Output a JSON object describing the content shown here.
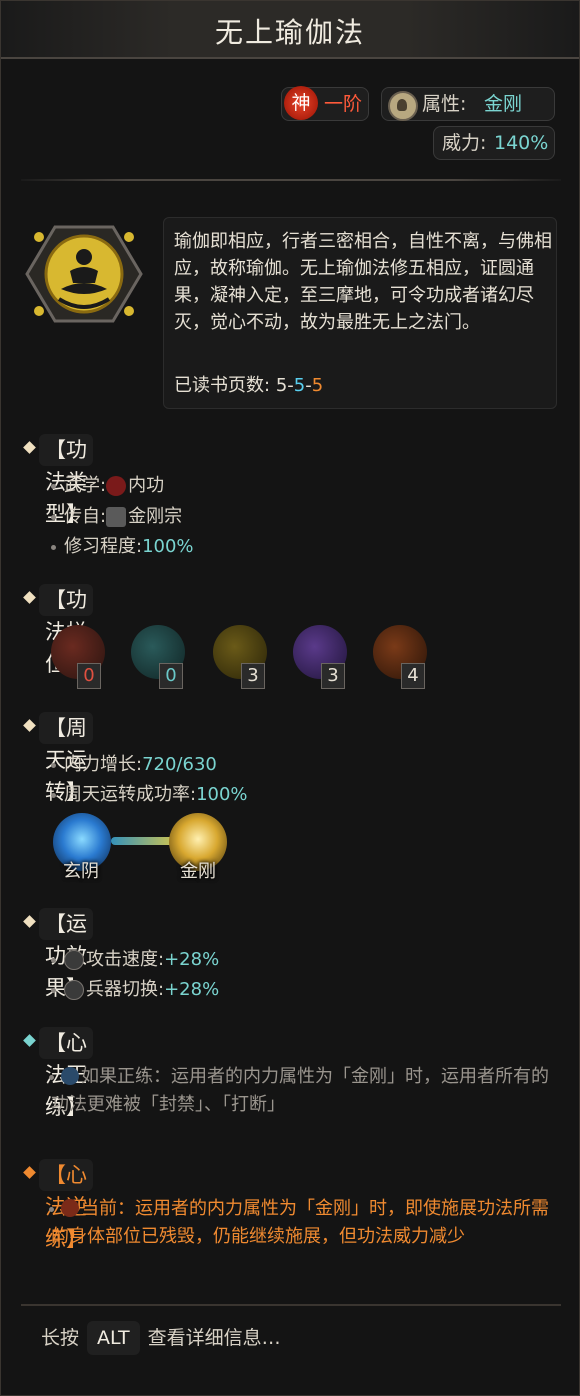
{
  "title": "无上瑜伽法",
  "rank": {
    "badge": "神",
    "label": "一阶"
  },
  "attribute": {
    "label": "属性:",
    "value": "金刚"
  },
  "power": {
    "label": "威力:",
    "value": "140%"
  },
  "description": "瑜伽即相应，行者三密相合，自性不离，与佛相应，故称瑜伽。无上瑜伽法修五相应，证圆通果，凝神入定，至三摩地，可令功成者诸幻尽灭，觉心不动，故为最胜无上之法门。",
  "pages_read": {
    "label": "已读书页数:",
    "v1": "5",
    "sep1": "-",
    "v2": "5",
    "sep2": "-",
    "v3": "5"
  },
  "type_section": {
    "header": "【功法类型】",
    "martial": {
      "label": "武学:",
      "value": "内功"
    },
    "origin": {
      "label": "传自:",
      "value": "金刚宗"
    },
    "mastery": {
      "label": "修习程度:",
      "value": "100%"
    }
  },
  "slots_section": {
    "header": "【功法栏位】",
    "slots": [
      {
        "num": "0",
        "color": "#c03a2a"
      },
      {
        "num": "0",
        "color": "#3a8a8a"
      },
      {
        "num": "3",
        "color": "#c0a020"
      },
      {
        "num": "3",
        "color": "#8a50c0"
      },
      {
        "num": "4",
        "color": "#c06a20"
      }
    ]
  },
  "circulation_section": {
    "header": "【周天运转】",
    "growth": {
      "label": "内力增长:",
      "value": "720/630"
    },
    "success": {
      "label": "周天运转成功率:",
      "value": "100%"
    },
    "from_orb": "玄阴",
    "to_orb": "金刚"
  },
  "effects_section": {
    "header": "【运功效果】",
    "effects": [
      {
        "label": "攻击速度:",
        "value": "+28%"
      },
      {
        "label": "兵器切换:",
        "value": "+28%"
      }
    ]
  },
  "forward_section": {
    "header": "【心法正练】",
    "text": "如果正练：运用者的内力属性为「金刚」时，运用者所有的功法更难被「封禁」、「打断」"
  },
  "reverse_section": {
    "header": "【心法逆练】",
    "text": "当前：运用者的内力属性为「金刚」时，即使施展功法所需的身体部位已残毁，仍能继续施展，但功法威力减少"
  },
  "footer": {
    "prefix": "长按",
    "key": "ALT",
    "suffix": "查看详细信息…"
  }
}
